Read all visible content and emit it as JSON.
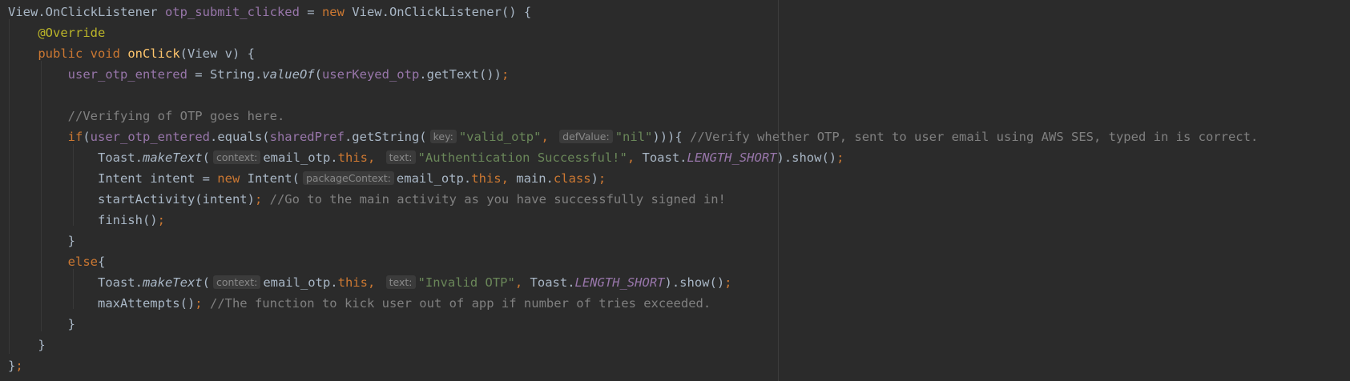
{
  "lines": [
    [
      {
        "t": "View.OnClickListener ",
        "c": "d"
      },
      {
        "t": "otp_submit_clicked",
        "c": "f"
      },
      {
        "t": " = ",
        "c": "d"
      },
      {
        "t": "new",
        "c": "k"
      },
      {
        "t": " View.OnClickListener() {",
        "c": "d"
      }
    ],
    [
      {
        "t": "    ",
        "c": "d"
      },
      {
        "t": "@Override",
        "c": "a"
      }
    ],
    [
      {
        "t": "    ",
        "c": "d"
      },
      {
        "t": "public void",
        "c": "k"
      },
      {
        "t": " ",
        "c": "d"
      },
      {
        "t": "onClick",
        "c": "m"
      },
      {
        "t": "(View v) {",
        "c": "d"
      }
    ],
    [
      {
        "t": "        ",
        "c": "d"
      },
      {
        "t": "user_otp_entered",
        "c": "f"
      },
      {
        "t": " = String.",
        "c": "d"
      },
      {
        "t": "valueOf",
        "c": "st"
      },
      {
        "t": "(",
        "c": "d"
      },
      {
        "t": "userKeyed_otp",
        "c": "f"
      },
      {
        "t": ".getText())",
        "c": "d"
      },
      {
        "t": ";",
        "c": "k"
      }
    ],
    [
      {
        "t": "",
        "c": "d"
      }
    ],
    [
      {
        "t": "        ",
        "c": "d"
      },
      {
        "t": "//Verifying of OTP goes here.",
        "c": "c"
      }
    ],
    [
      {
        "t": "        ",
        "c": "d"
      },
      {
        "t": "if",
        "c": "k"
      },
      {
        "t": "(",
        "c": "d"
      },
      {
        "t": "user_otp_entered",
        "c": "f"
      },
      {
        "t": ".equals(",
        "c": "d"
      },
      {
        "t": "sharedPref",
        "c": "f"
      },
      {
        "t": ".getString(",
        "c": "d"
      },
      {
        "t": "key:",
        "c": "hint"
      },
      {
        "t": "\"valid_otp\"",
        "c": "s"
      },
      {
        "t": ", ",
        "c": "k"
      },
      {
        "t": "defValue:",
        "c": "hint"
      },
      {
        "t": "\"nil\"",
        "c": "s"
      },
      {
        "t": "))){ ",
        "c": "d"
      },
      {
        "t": "//Verify whether OTP, sent to user email using AWS SES, typed in is correct.",
        "c": "c"
      }
    ],
    [
      {
        "t": "            Toast.",
        "c": "d"
      },
      {
        "t": "makeText",
        "c": "st"
      },
      {
        "t": "(",
        "c": "d"
      },
      {
        "t": "context:",
        "c": "hint"
      },
      {
        "t": "email_otp.",
        "c": "d"
      },
      {
        "t": "this",
        "c": "k"
      },
      {
        "t": ", ",
        "c": "k"
      },
      {
        "t": "text:",
        "c": "hint"
      },
      {
        "t": "\"Authentication Successful!\"",
        "c": "s"
      },
      {
        "t": ", ",
        "c": "k"
      },
      {
        "t": "Toast.",
        "c": "d"
      },
      {
        "t": "LENGTH_SHORT",
        "c": "fi"
      },
      {
        "t": ").show()",
        "c": "d"
      },
      {
        "t": ";",
        "c": "k"
      }
    ],
    [
      {
        "t": "            Intent intent = ",
        "c": "d"
      },
      {
        "t": "new",
        "c": "k"
      },
      {
        "t": " Intent(",
        "c": "d"
      },
      {
        "t": "packageContext:",
        "c": "hint"
      },
      {
        "t": "email_otp.",
        "c": "d"
      },
      {
        "t": "this",
        "c": "k"
      },
      {
        "t": ", ",
        "c": "k"
      },
      {
        "t": "main.",
        "c": "d"
      },
      {
        "t": "class",
        "c": "k"
      },
      {
        "t": ")",
        "c": "d"
      },
      {
        "t": ";",
        "c": "k"
      }
    ],
    [
      {
        "t": "            startActivity(intent)",
        "c": "d"
      },
      {
        "t": ";",
        "c": "k"
      },
      {
        "t": " ",
        "c": "d"
      },
      {
        "t": "//Go to the main activity as you have successfully signed in!",
        "c": "c"
      }
    ],
    [
      {
        "t": "            finish()",
        "c": "d"
      },
      {
        "t": ";",
        "c": "k"
      }
    ],
    [
      {
        "t": "        }",
        "c": "d"
      }
    ],
    [
      {
        "t": "        ",
        "c": "d"
      },
      {
        "t": "else",
        "c": "k"
      },
      {
        "t": "{",
        "c": "d"
      }
    ],
    [
      {
        "t": "            Toast.",
        "c": "d"
      },
      {
        "t": "makeText",
        "c": "st"
      },
      {
        "t": "(",
        "c": "d"
      },
      {
        "t": "context:",
        "c": "hint"
      },
      {
        "t": "email_otp.",
        "c": "d"
      },
      {
        "t": "this",
        "c": "k"
      },
      {
        "t": ", ",
        "c": "k"
      },
      {
        "t": "text:",
        "c": "hint"
      },
      {
        "t": "\"Invalid OTP\"",
        "c": "s"
      },
      {
        "t": ", ",
        "c": "k"
      },
      {
        "t": "Toast.",
        "c": "d"
      },
      {
        "t": "LENGTH_SHORT",
        "c": "fi"
      },
      {
        "t": ").show()",
        "c": "d"
      },
      {
        "t": ";",
        "c": "k"
      }
    ],
    [
      {
        "t": "            maxAttempts()",
        "c": "d"
      },
      {
        "t": ";",
        "c": "k"
      },
      {
        "t": " ",
        "c": "d"
      },
      {
        "t": "//The function to kick user out of app if number of tries exceeded.",
        "c": "c"
      }
    ],
    [
      {
        "t": "        }",
        "c": "d"
      }
    ],
    [
      {
        "t": "    }",
        "c": "d"
      }
    ],
    [
      {
        "t": "}",
        "c": "d"
      },
      {
        "t": ";",
        "c": "k"
      }
    ]
  ],
  "colors": {
    "background": "#2b2b2b",
    "default": "#a9b7c6",
    "keyword": "#cc7832",
    "string": "#6a8759",
    "comment": "#808080",
    "field": "#9876aa",
    "annotation": "#bbb529",
    "method_declaration": "#ffc66d",
    "inlay_hint": "#888888"
  }
}
